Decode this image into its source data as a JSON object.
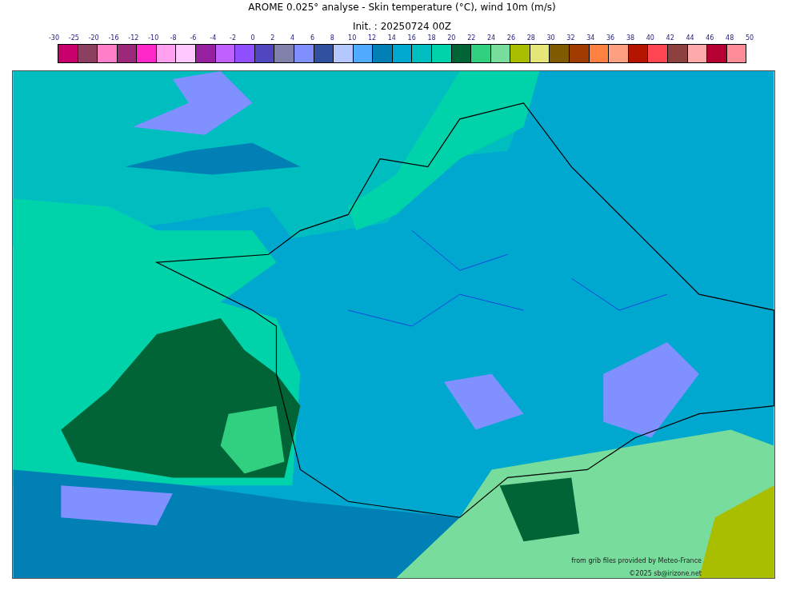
{
  "title": "AROME 0.025° analyse - Skin temperature (°C), wind 10m (m/s)",
  "subtitle": "Init. : 20250724 00Z",
  "legend": {
    "ticks": [
      "-30",
      "-25",
      "-20",
      "-16",
      "-12",
      "-10",
      "-8",
      "-6",
      "-4",
      "-2",
      "0",
      "2",
      "4",
      "6",
      "8",
      "10",
      "12",
      "14",
      "16",
      "18",
      "20",
      "22",
      "24",
      "26",
      "28",
      "30",
      "32",
      "34",
      "36",
      "38",
      "40",
      "42",
      "44",
      "46",
      "48",
      "50"
    ],
    "swatches": [
      {
        "color": "#c8006e"
      },
      {
        "color": "#8b4060"
      },
      {
        "color": "#ff80c8"
      },
      {
        "color": "#9b2878"
      },
      {
        "color": "#ff28c8"
      },
      {
        "color": "#ffa0f0"
      },
      {
        "color": "#ffc8ff"
      },
      {
        "color": "#9620a0"
      },
      {
        "color": "#c060ff"
      },
      {
        "color": "#9050ff"
      },
      {
        "color": "#5046c0"
      },
      {
        "color": "#8080aa"
      },
      {
        "color": "#8090ff"
      },
      {
        "color": "#3050a0"
      },
      {
        "color": "#b4c8ff"
      },
      {
        "color": "#50aaff"
      },
      {
        "color": "#0080b4"
      },
      {
        "color": "#00a8d0"
      },
      {
        "color": "#00bec0"
      },
      {
        "color": "#00d2aa"
      },
      {
        "color": "#006437"
      },
      {
        "color": "#30d080"
      },
      {
        "color": "#78dc9c"
      },
      {
        "color": "#aabe00"
      },
      {
        "color": "#e6e678"
      },
      {
        "color": "#805a00"
      },
      {
        "color": "#a03c00"
      },
      {
        "color": "#ff8040"
      },
      {
        "color": "#ffa080"
      },
      {
        "color": "#b41400"
      },
      {
        "color": "#ff4650"
      },
      {
        "color": "#8c4040"
      },
      {
        "color": "#ffaaaa"
      },
      {
        "color": "#b40032"
      },
      {
        "color": "#ff8c96"
      }
    ]
  },
  "credits": [
    "from grib files provided by Meteo-France",
    "©2025 sb@irizone.net"
  ]
}
